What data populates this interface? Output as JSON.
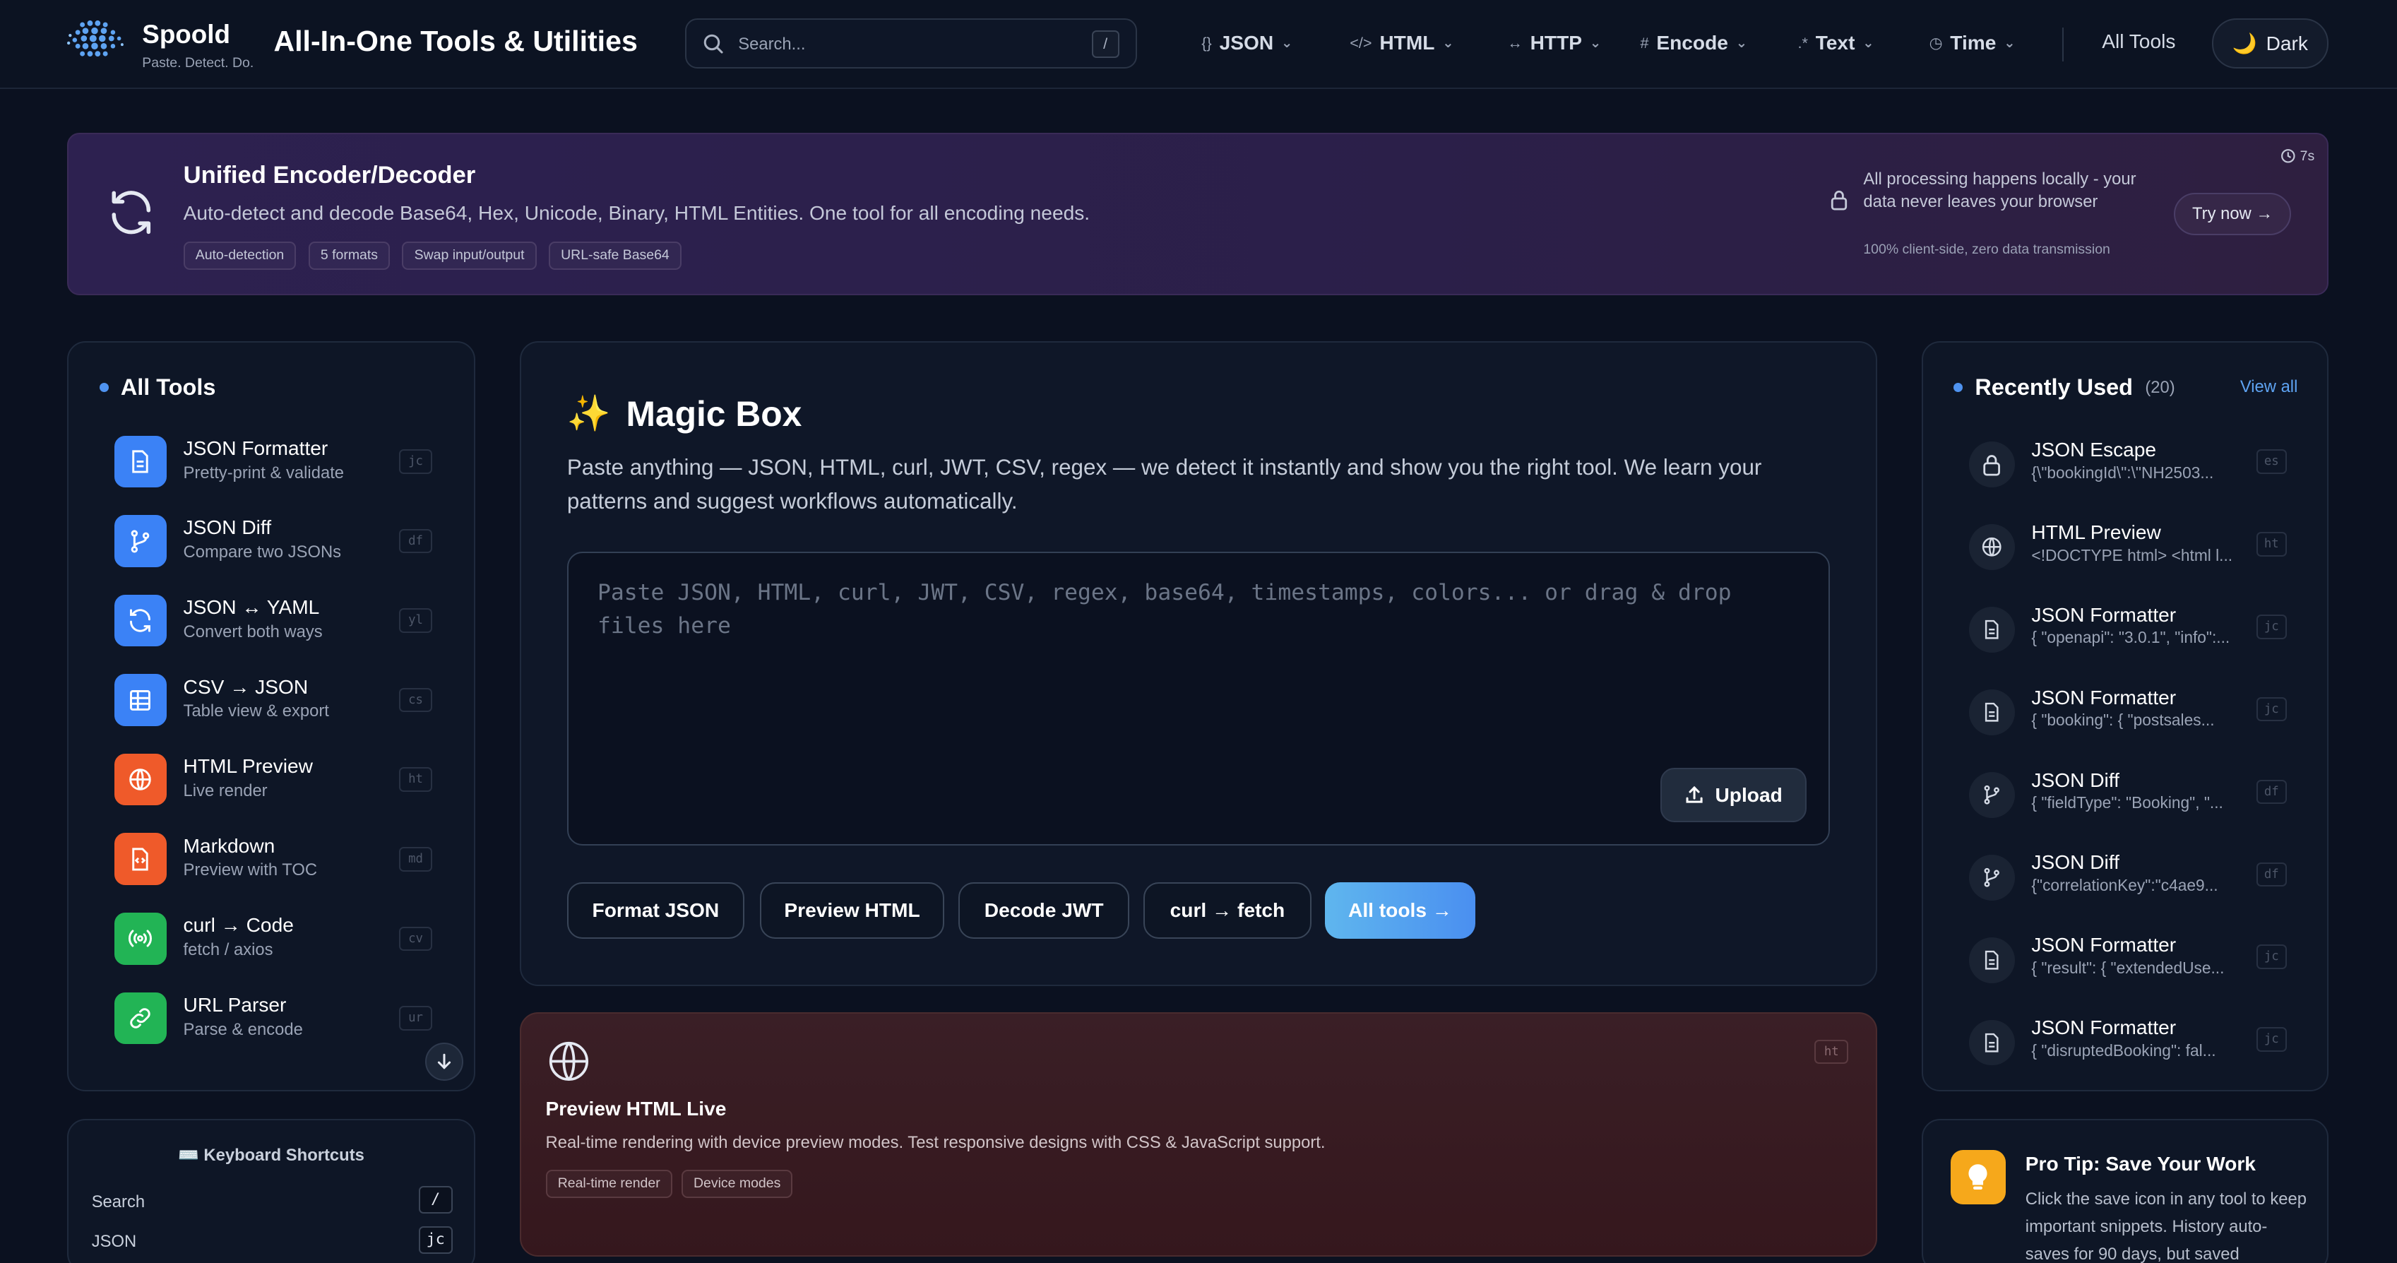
{
  "header": {
    "brand_name": "Spoold",
    "brand_tagline": "Paste. Detect. Do.",
    "app_title": "All-In-One Tools & Utilities",
    "search_placeholder": "Search...",
    "search_shortcut": "/",
    "nav": [
      {
        "glyph": "{}",
        "label": "JSON"
      },
      {
        "glyph": "</>",
        "label": "HTML"
      },
      {
        "glyph": "↔",
        "label": "HTTP"
      },
      {
        "glyph": "#",
        "label": "Encode"
      },
      {
        "glyph": ".*",
        "label": "Text"
      },
      {
        "glyph": "◷",
        "label": "Time"
      }
    ],
    "all_tools": "All Tools",
    "theme_label": "Dark"
  },
  "banner": {
    "title": "Unified Encoder/Decoder",
    "description": "Auto-detect and decode Base64, Hex, Unicode, Binary, HTML Entities. One tool for all encoding needs.",
    "tags": [
      "Auto-detection",
      "5 formats",
      "Swap input/output",
      "URL-safe Base64"
    ],
    "privacy_note": "All processing happens locally - your data never leaves your browser",
    "privacy_subnote": "100% client-side, zero data transmission",
    "cta": "Try now →",
    "timer": "7s"
  },
  "sidebar": {
    "heading": "All Tools",
    "items": [
      {
        "name": "JSON Formatter",
        "sub": "Pretty-print & validate",
        "kbd": "jc",
        "icon": "document-icon",
        "color": "#3b82f6"
      },
      {
        "name": "JSON Diff",
        "sub": "Compare two JSONs",
        "kbd": "df",
        "icon": "branch-icon",
        "color": "#3b82f6"
      },
      {
        "name": "JSON ↔ YAML",
        "sub": "Convert both ways",
        "kbd": "yl",
        "icon": "refresh-icon",
        "color": "#3b82f6"
      },
      {
        "name": "CSV → JSON",
        "sub": "Table view & export",
        "kbd": "cs",
        "icon": "table-icon",
        "color": "#3b82f6"
      },
      {
        "name": "HTML Preview",
        "sub": "Live render",
        "kbd": "ht",
        "icon": "globe-icon",
        "color": "#ef5a2a"
      },
      {
        "name": "Markdown",
        "sub": "Preview with TOC",
        "kbd": "md",
        "icon": "code-file-icon",
        "color": "#ef5a2a"
      },
      {
        "name": "curl → Code",
        "sub": "fetch / axios",
        "kbd": "cv",
        "icon": "broadcast-icon",
        "color": "#22b455"
      },
      {
        "name": "URL Parser",
        "sub": "Parse & encode",
        "kbd": "ur",
        "icon": "link-icon",
        "color": "#22b455"
      }
    ]
  },
  "shortcuts": {
    "title": "⌨️ Keyboard Shortcuts",
    "rows": [
      {
        "label": "Search",
        "key": "/"
      },
      {
        "label": "JSON",
        "key": "jc"
      }
    ]
  },
  "magic_box": {
    "title": "Magic Box",
    "emoji": "✨",
    "description": "Paste anything — JSON, HTML, curl, JWT, CSV, regex — we detect it instantly and show you the right tool. We learn your patterns and suggest workflows automatically.",
    "placeholder": "Paste JSON, HTML, curl, JWT, CSV, regex, base64, timestamps, colors... or drag & drop files here",
    "upload": "Upload",
    "quick_actions": [
      "Format JSON",
      "Preview HTML",
      "Decode JWT",
      "curl → fetch",
      "All tools →"
    ]
  },
  "html_card": {
    "title": "Preview HTML Live",
    "description": "Real-time rendering with device preview modes. Test responsive designs with CSS & JavaScript support.",
    "tags": [
      "Real-time render",
      "Device modes"
    ],
    "kbd": "ht"
  },
  "recent": {
    "heading": "Recently Used",
    "count": "(20)",
    "view_all": "View all",
    "items": [
      {
        "name": "JSON Escape",
        "snippet": "{\\\"bookingId\\\":\\\"NH2503...",
        "kbd": "es",
        "icon": "lock-icon"
      },
      {
        "name": "HTML Preview",
        "snippet": "<!DOCTYPE html> <html l...",
        "kbd": "ht",
        "icon": "globe-icon"
      },
      {
        "name": "JSON Formatter",
        "snippet": "{ \"openapi\": \"3.0.1\", \"info\":...",
        "kbd": "jc",
        "icon": "document-icon"
      },
      {
        "name": "JSON Formatter",
        "snippet": "{ \"booking\": { \"postsales...",
        "kbd": "jc",
        "icon": "document-icon"
      },
      {
        "name": "JSON Diff",
        "snippet": "{ \"fieldType\": \"Booking\", \"...",
        "kbd": "df",
        "icon": "branch-icon"
      },
      {
        "name": "JSON Diff",
        "snippet": "{\"correlationKey\":\"c4ae9...",
        "kbd": "df",
        "icon": "branch-icon"
      },
      {
        "name": "JSON Formatter",
        "snippet": "{ \"result\": { \"extendedUse...",
        "kbd": "jc",
        "icon": "document-icon"
      },
      {
        "name": "JSON Formatter",
        "snippet": "{ \"disruptedBooking\": fal...",
        "kbd": "jc",
        "icon": "document-icon"
      }
    ]
  },
  "protip": {
    "title": "Pro Tip: Save Your Work",
    "body": "Click the save icon in any tool to keep important snippets. History auto-saves for 90 days, but saved"
  }
}
